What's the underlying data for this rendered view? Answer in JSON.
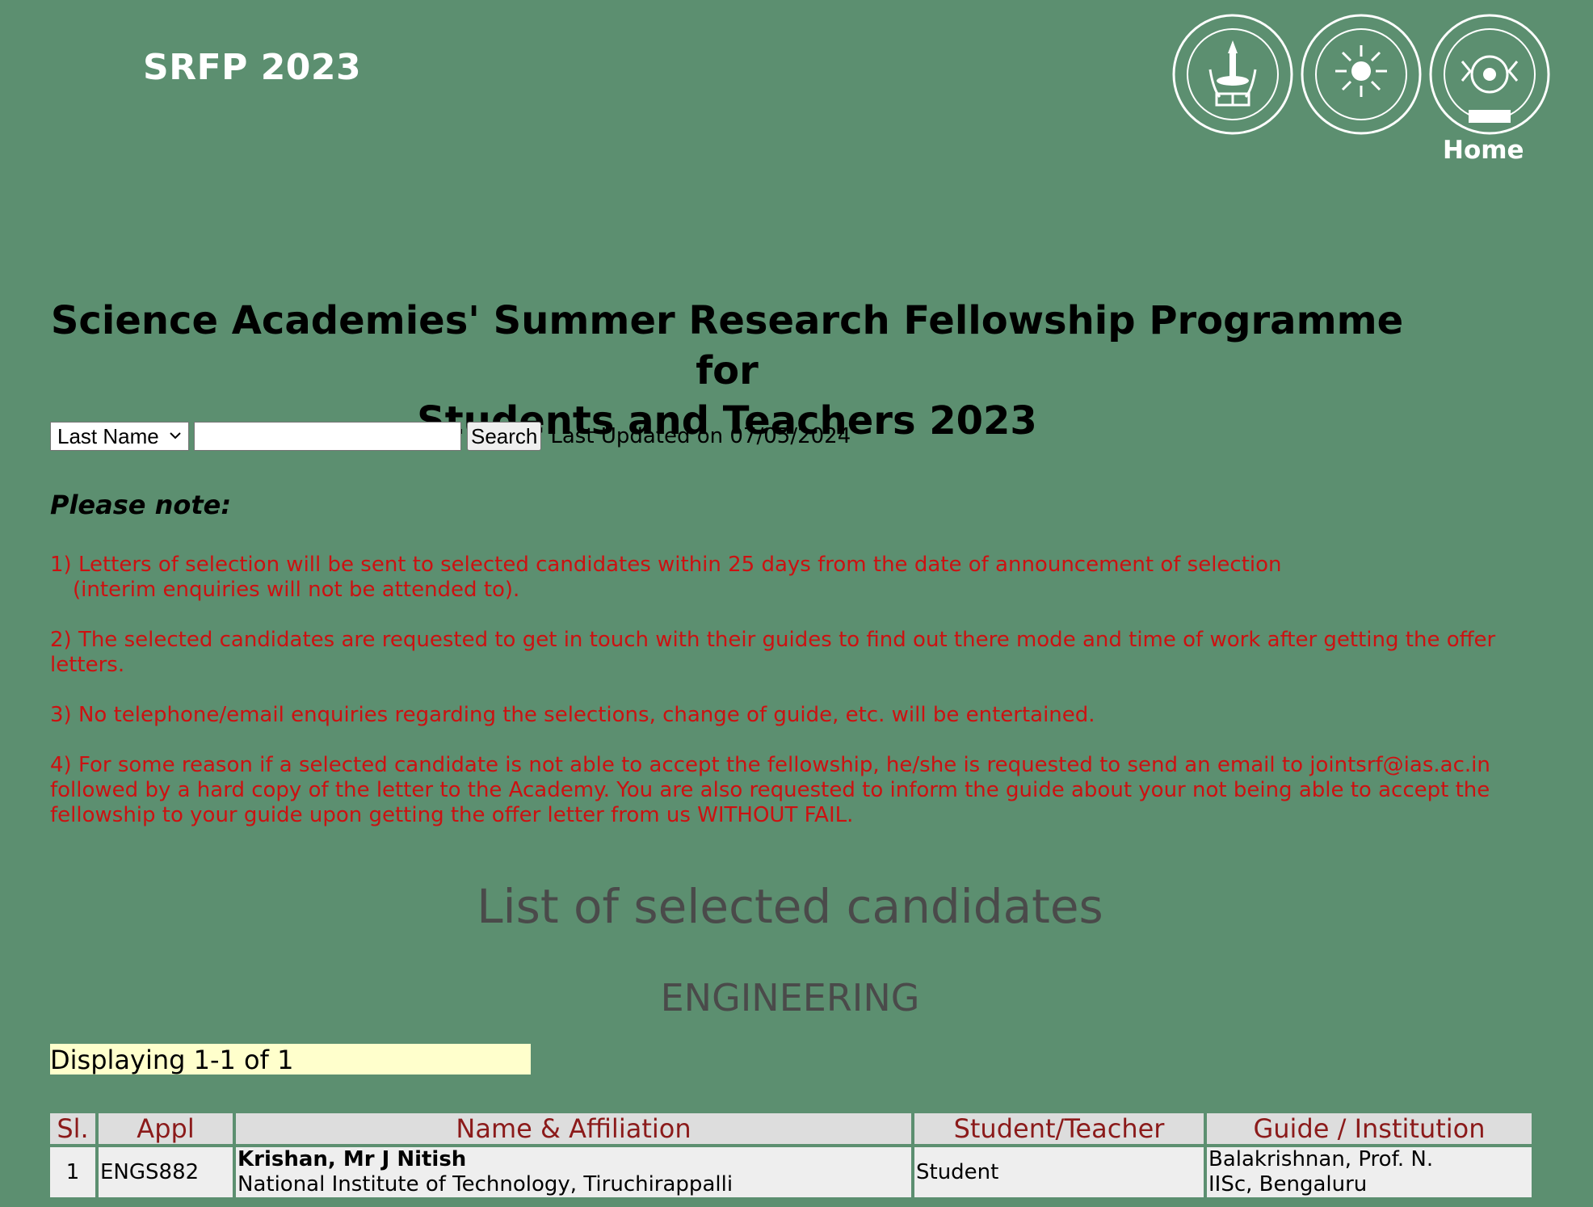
{
  "header": {
    "site_title": "SRFP 2023",
    "home_label": "Home",
    "logos": [
      {
        "name": "indian-academy-of-sciences-logo",
        "text": "INDIAN ACADEMY OF SCIENCES"
      },
      {
        "name": "indian-national-science-academy-logo",
        "text": "INDIAN NATIONAL SCIENCE ACADEMY"
      },
      {
        "name": "national-academy-of-sciences-logo",
        "text": "THE NATIONAL ACADEMY OF SCIENCES INDIA"
      }
    ]
  },
  "main": {
    "heading_line1": "Science Academies' Summer Research Fellowship Programme for",
    "heading_line2": "Students and Teachers 2023"
  },
  "search": {
    "field_selected": "Last Name",
    "input_value": "",
    "button_label": "Search",
    "last_updated": "Last Updated on 07/05/2024"
  },
  "notes": {
    "heading": "Please note:",
    "items": [
      "1) Letters of selection will be sent to selected candidates within 25 days from the date of announcement of selection",
      "(interim enquiries will not be attended to).",
      "2) The selected candidates are requested to get in touch with their guides to find out there mode and time of work after getting the offer letters.",
      "3) No telephone/email enquiries regarding the selections, change of guide, etc. will be entertained.",
      "4) For some reason if a selected candidate is not able to accept the fellowship, he/she is requested to send an email to jointsrf@ias.ac.in followed by a hard copy of the letter to the Academy. You are also requested to inform the guide about your not being able to accept the fellowship to your guide upon getting the offer letter from us WITHOUT FAIL."
    ]
  },
  "results": {
    "title": "List of selected candidates",
    "category": "ENGINEERING",
    "displaying": "Displaying 1-1 of 1",
    "columns": [
      "Sl.",
      "Appl",
      "Name & Affiliation",
      "Student/Teacher",
      "Guide / Institution"
    ],
    "rows": [
      {
        "sl": "1",
        "appl": "ENGS882",
        "name": "Krishan, Mr J Nitish",
        "affiliation": "National Institute of Technology, Tiruchirappalli",
        "type": "Student",
        "guide": "Balakrishnan, Prof.  N.",
        "institution": "IISc, Bengaluru"
      }
    ]
  },
  "colors": {
    "background": "#5c8f70",
    "notes_text": "#cc1111",
    "table_header_text": "#8b1a1a",
    "displaying_bg": "#ffffcc"
  }
}
